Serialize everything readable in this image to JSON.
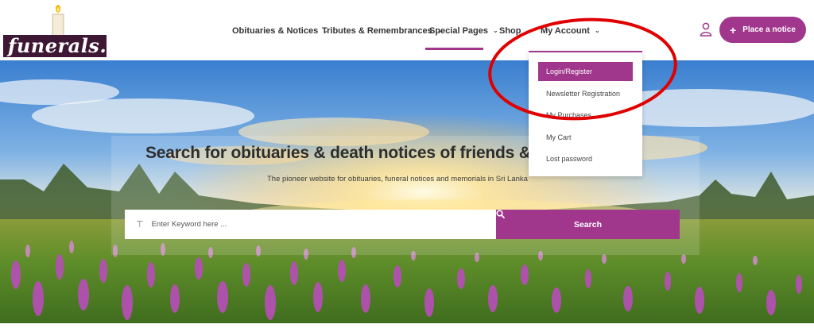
{
  "brand": {
    "logo_text": "funerals.lk",
    "accent_color": "#a0378c",
    "logo_bg": "#3d1733"
  },
  "nav": {
    "items": [
      {
        "label": "Obituaries & Notices",
        "has_dropdown": true
      },
      {
        "label": "Tributes & Remembrances",
        "has_dropdown": true
      },
      {
        "label": "Special Pages",
        "has_dropdown": true,
        "active": true
      },
      {
        "label": "Shop",
        "has_dropdown": false
      },
      {
        "label": "My Account",
        "has_dropdown": true
      }
    ],
    "user_icon": "user-icon",
    "cta_label": "Place a notice",
    "cta_icon": "plus-icon"
  },
  "account_menu": {
    "items": [
      {
        "label": "Login/Register",
        "highlighted": true
      },
      {
        "label": "Newsletter Registration"
      },
      {
        "label": "My Purchases"
      },
      {
        "label": "My Cart"
      },
      {
        "label": "Lost password"
      }
    ]
  },
  "hero": {
    "title": "Search for obituaries & death notices of friends & relatives...",
    "subtitle": "The pioneer website for obituaries, funeral notices and memorials in Sri Lanka",
    "search_placeholder": "Enter Keyword here ...",
    "search_icon": "text-cursor-icon",
    "search_button": "Search",
    "search_button_icon": "search-icon"
  },
  "annotation": {
    "shape": "red ellipse",
    "color": "#e00000",
    "target": "My Account menu"
  }
}
